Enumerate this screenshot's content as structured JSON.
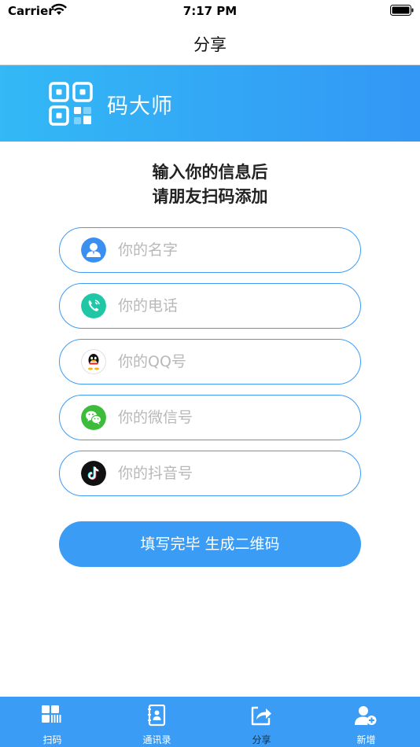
{
  "status_bar": {
    "carrier": "Carrier",
    "time": "7:17 PM"
  },
  "nav": {
    "title": "分享"
  },
  "banner": {
    "app_name": "码大师"
  },
  "intro": {
    "line1": "输入你的信息后",
    "line2": "请朋友扫码添加"
  },
  "fields": [
    {
      "placeholder": "你的名字",
      "value": "",
      "icon": "user-icon",
      "icon_color": "#3a8ff0"
    },
    {
      "placeholder": "你的电话",
      "value": "",
      "icon": "phone-icon",
      "icon_color": "#20c7a6"
    },
    {
      "placeholder": "你的QQ号",
      "value": "",
      "icon": "qq-icon",
      "icon_color": "#ffffff"
    },
    {
      "placeholder": "你的微信号",
      "value": "",
      "icon": "wechat-icon",
      "icon_color": "#3dbb3a"
    },
    {
      "placeholder": "你的抖音号",
      "value": "",
      "icon": "tiktok-icon",
      "icon_color": "#111111"
    }
  ],
  "submit_label": "填写完毕 生成二维码",
  "tabs": [
    {
      "label": "扫码",
      "icon": "scan-icon",
      "active": false
    },
    {
      "label": "通讯录",
      "icon": "contacts-icon",
      "active": false
    },
    {
      "label": "分享",
      "icon": "share-icon",
      "active": true
    },
    {
      "label": "新增",
      "icon": "add-user-icon",
      "active": false
    }
  ],
  "colors": {
    "accent": "#3a9cf5",
    "banner_start": "#33b9f5",
    "banner_end": "#3397f5",
    "field_border": "#3e9cf7"
  }
}
